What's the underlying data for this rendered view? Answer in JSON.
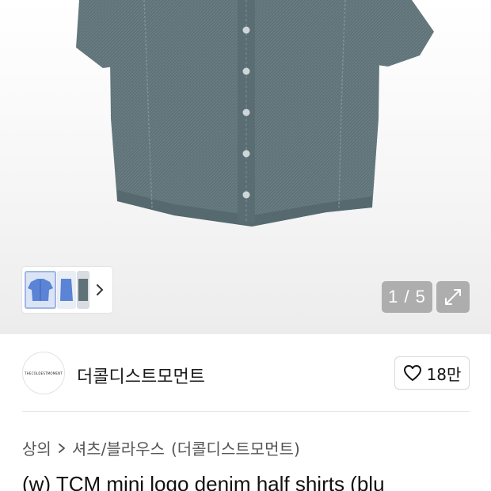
{
  "gallery": {
    "page_current": "1",
    "page_total": "5",
    "page_counter_text": "1 / 5",
    "shirt_color": "#5f7278",
    "thumbnails": [
      "blue-shirt-front",
      "blue-shirt-side",
      "denim-shirt-back"
    ]
  },
  "shop": {
    "name": "더콜디스트모먼트",
    "logo_text": "THECOLDESTMOMENT",
    "like_count": "18만"
  },
  "breadcrumb": {
    "category": "상의",
    "subcategory": "셔츠/블라우스",
    "brand": "(더콜디스트모먼트)"
  },
  "product": {
    "title": "(w) TCM mini logo denim half shirts (blu"
  },
  "colors": {
    "overlay": "#787878",
    "text_primary": "#111111",
    "text_secondary": "#555555"
  }
}
